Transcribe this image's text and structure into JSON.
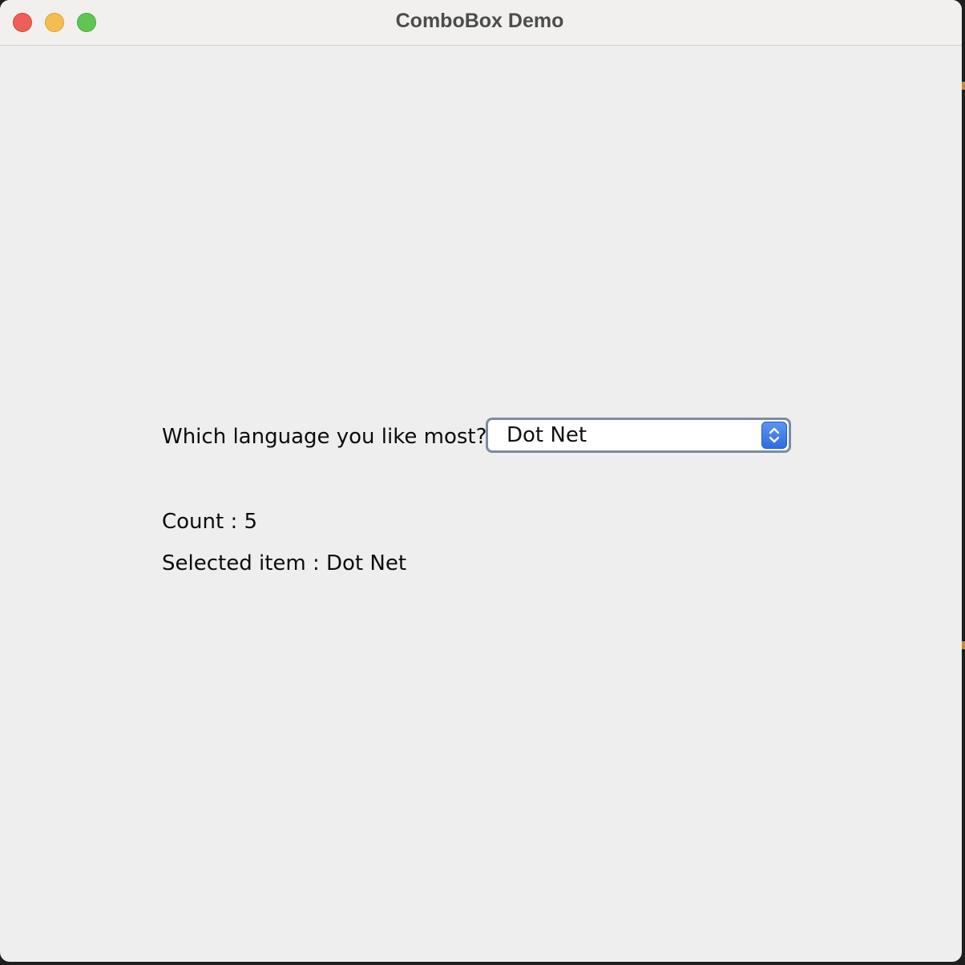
{
  "window": {
    "title": "ComboBox Demo"
  },
  "form": {
    "question_label": "Which language you like most?",
    "combo_selected_value": "Dot Net",
    "count_text": "Count : 5",
    "selected_text": "Selected item : Dot Net"
  },
  "icons": {
    "close": "close-traffic-light",
    "minimize": "minimize-traffic-light",
    "zoom": "zoom-traffic-light",
    "combo_arrow": "up-down-chevron-icon"
  },
  "colors": {
    "window_bg": "#eeeeee",
    "titlebar_bg": "#f1f0ef",
    "close": "#ee5f57",
    "minimize": "#f4bd4f",
    "zoom": "#61c554",
    "combo_border": "#7d8aa3",
    "combo_arrow": "#3a7be6"
  }
}
